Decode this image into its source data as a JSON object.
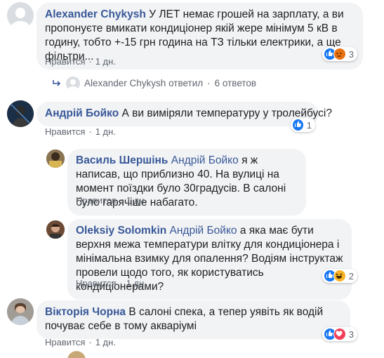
{
  "comments": [
    {
      "author": "Alexander Chykysh",
      "text": "У ЛЕТ немає грошей на зарплату, а ви пропонуєте вмикати кондиціонер якій жере мінімум 5 кВ в годину, тобто +-15 грн година на ТЗ тільки електрики, а ще фільтри...",
      "like_label": "Нравится",
      "time": "1 дн.",
      "reaction_count": "3"
    },
    {
      "author": "Андрій Бойко",
      "text": "А ви виміряли температуру у тролейбусі?",
      "like_label": "Нравится",
      "time": "1 дн.",
      "reaction_count": "1"
    },
    {
      "author": "Василь Шершінь",
      "mention": "Андрій Бойко",
      "text": "я ж написав, що приблизно 40. На вулиці на момент поїздки було 30градусів. В салоні було гарячіше набагато.",
      "like_label": "Нравится",
      "time": "1 дн."
    },
    {
      "author": "Oleksiy Solomkin",
      "mention": "Андрій Бойко",
      "text": "а яка має бути верхня межа температури влітку для кондиціонера і мінімальна взимку для опалення? Водіям інструктаж провели щодо того, як користуватись кондиціонерами?",
      "like_label": "Нравится",
      "time": "1 дн.",
      "reaction_count": "2"
    },
    {
      "author": "Вікторія Чорна",
      "text": "В салоні спека, а тепер уявіть як водій почуває себе в тому акваріумі",
      "like_label": "Нравится",
      "time": "1 дн.",
      "reaction_count": "3"
    }
  ],
  "replies_link": {
    "author": "Alexander Chykysh",
    "verb": "ответил",
    "count_label": "6 ответов"
  },
  "colors": {
    "link": "#385898",
    "bubble": "#f2f3f5",
    "like": "#1877f2",
    "angry": "#e9710f",
    "love": "#f33e58",
    "haha": "#f7b125"
  }
}
